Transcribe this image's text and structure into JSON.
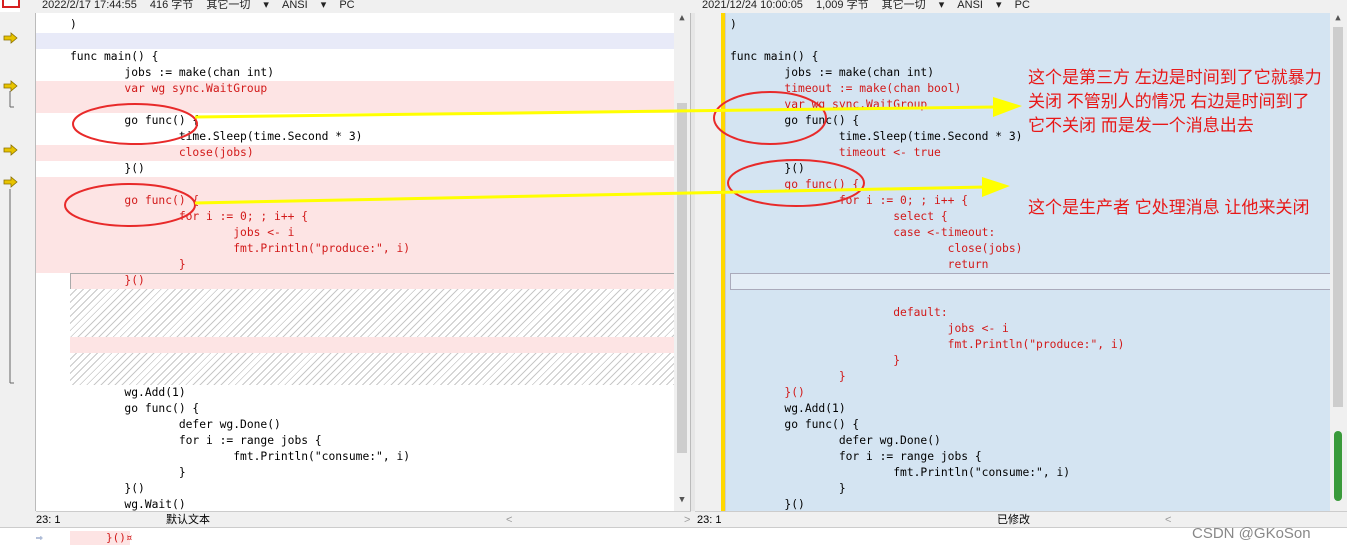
{
  "left_header": {
    "date": "2022/2/17 17:44:55",
    "size": "416 字节",
    "mode": "其它一切",
    "encoding": "ANSI",
    "eol": "PC"
  },
  "right_header": {
    "date": "2021/12/24 10:00:05",
    "size": "1,009 字节",
    "mode": "其它一切",
    "encoding": "ANSI",
    "eol": "PC"
  },
  "left_lines": [
    ")",
    "",
    "func main() {",
    "        jobs := make(chan int)",
    "        var wg sync.WaitGroup",
    "",
    "        go func() {",
    "                time.Sleep(time.Second * 3)",
    "                close(jobs)",
    "        }()",
    "",
    "        go func() {",
    "                for i := 0; ; i++ {",
    "                        jobs <- i",
    "                        fmt.Println(\"produce:\", i)",
    "                }",
    "        }()",
    "",
    "",
    "",
    "",
    "",
    "",
    "        wg.Add(1)",
    "        go func() {",
    "                defer wg.Done()",
    "                for i := range jobs {",
    "                        fmt.Println(\"consume:\", i)",
    "                }",
    "        }()",
    "        wg.Wait()"
  ],
  "right_lines": [
    ")",
    "",
    "func main() {",
    "        jobs := make(chan int)",
    "        timeout := make(chan bool)",
    "        var wg sync.WaitGroup",
    "        go func() {",
    "                time.Sleep(time.Second * 3)",
    "                timeout <- true",
    "        }()",
    "        go func() {",
    "                for i := 0; ; i++ {",
    "                        select {",
    "                        case <-timeout:",
    "                                close(jobs)",
    "                                return",
    "",
    "",
    "                        default:",
    "                                jobs <- i",
    "                                fmt.Println(\"produce:\", i)",
    "                        }",
    "                }",
    "        }()",
    "        wg.Add(1)",
    "        go func() {",
    "                defer wg.Done()",
    "                for i := range jobs {",
    "                        fmt.Println(\"consume:\", i)",
    "                }",
    "        }()",
    "        wg.Wait()"
  ],
  "annotations": {
    "note1": "这个是第三方 左边是时间到了它就暴力关闭 不管别人的情况 右边是时间到了 它不关闭 而是发一个消息出去",
    "note2": "这个是生产者 它处理消息 让他来关闭"
  },
  "left_status": {
    "position": "23: 1",
    "state": "默认文本"
  },
  "right_status": {
    "position": "23: 1",
    "state": "已修改"
  },
  "bottom_bar": {
    "text": "}()¤"
  },
  "watermark": "CSDN @GKoSon",
  "colors": {
    "diff_bg": "#fde4e4",
    "right_bg": "#d4e4f2",
    "added_text": "#d21a1a",
    "note": "#e81818",
    "arrow": "#ffff00"
  }
}
